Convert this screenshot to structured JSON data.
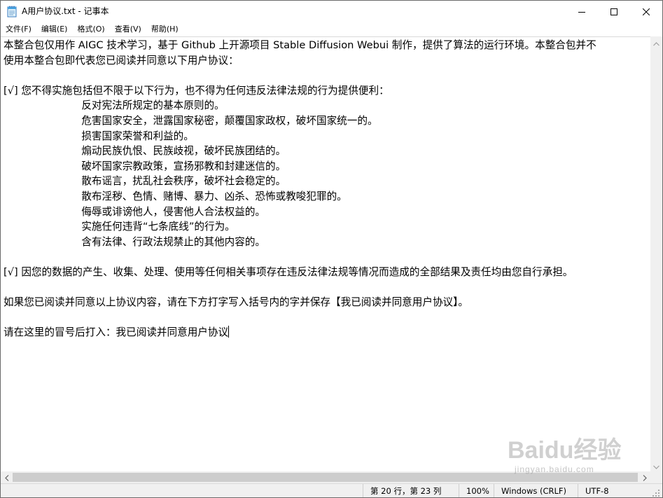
{
  "window": {
    "title": "A用户协议.txt - 记事本",
    "icon": "notepad-icon",
    "controls": [
      "minimize-icon",
      "maximize-icon",
      "close-icon"
    ]
  },
  "menu": {
    "items": [
      {
        "label": "文件(F)"
      },
      {
        "label": "编辑(E)"
      },
      {
        "label": "格式(O)"
      },
      {
        "label": "查看(V)"
      },
      {
        "label": "帮助(H)"
      }
    ]
  },
  "document": {
    "text": "本整合包仅用作 AIGC 技术学习，基于 Github 上开源项目 Stable Diffusion Webui 制作，提供了算法的运行环境。本整合包并不\n使用本整合包即代表您已阅读并同意以下用户协议：\n\n[√] 您不得实施包括但不限于以下行为，也不得为任何违反法律法规的行为提供便利：\n                        反对宪法所规定的基本原则的。\n                        危害国家安全，泄露国家秘密，颠覆国家政权，破坏国家统一的。\n                        损害国家荣誉和利益的。\n                        煽动民族仇恨、民族歧视，破坏民族团结的。\n                        破坏国家宗教政策，宣扬邪教和封建迷信的。\n                        散布谣言，扰乱社会秩序，破坏社会稳定的。\n                        散布淫秽、色情、赌博、暴力、凶杀、恐怖或教唆犯罪的。\n                        侮辱或诽谤他人，侵害他人合法权益的。\n                        实施任何违背“七条底线”的行为。\n                        含有法律、行政法规禁止的其他内容的。\n\n[√] 因您的数据的产生、收集、处理、使用等任何相关事项存在违反法律法规等情况而造成的全部结果及责任均由您自行承担。\n\n如果您已阅读并同意以上协议内容，请在下方打字写入括号内的字并保存【我已阅读并同意用户协议】。\n\n请在这里的冒号后打入：我已阅读并同意用户协议"
  },
  "status": {
    "position": "第 20 行，第 23 列",
    "zoom": "100%",
    "line_ending": "Windows (CRLF)",
    "encoding": "UTF-8"
  },
  "watermark": {
    "logo": "Baidu经验",
    "url": "jingyan.baidu.com"
  },
  "colors": {
    "scrollbar_bg": "#f0f0f0",
    "scroll_thumb": "#cdcdcd",
    "statusbar_bg": "#f0f0f0"
  }
}
